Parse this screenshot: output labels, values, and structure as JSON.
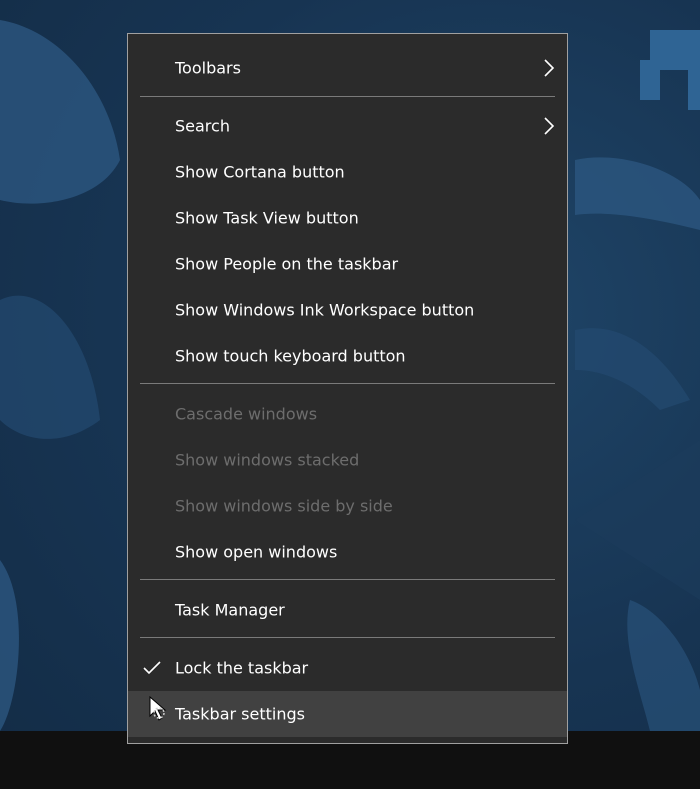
{
  "menu": {
    "items": [
      {
        "label": "Toolbars",
        "enabled": true,
        "has_submenu": true,
        "checked": false
      },
      {
        "label": "Search",
        "enabled": true,
        "has_submenu": true,
        "checked": false
      },
      {
        "label": "Show Cortana button",
        "enabled": true,
        "has_submenu": false,
        "checked": false
      },
      {
        "label": "Show Task View button",
        "enabled": true,
        "has_submenu": false,
        "checked": false
      },
      {
        "label": "Show People on the taskbar",
        "enabled": true,
        "has_submenu": false,
        "checked": false
      },
      {
        "label": "Show Windows Ink Workspace button",
        "enabled": true,
        "has_submenu": false,
        "checked": false
      },
      {
        "label": "Show touch keyboard button",
        "enabled": true,
        "has_submenu": false,
        "checked": false
      },
      {
        "label": "Cascade windows",
        "enabled": false,
        "has_submenu": false,
        "checked": false
      },
      {
        "label": "Show windows stacked",
        "enabled": false,
        "has_submenu": false,
        "checked": false
      },
      {
        "label": "Show windows side by side",
        "enabled": false,
        "has_submenu": false,
        "checked": false
      },
      {
        "label": "Show open windows",
        "enabled": true,
        "has_submenu": false,
        "checked": false
      },
      {
        "label": "Task Manager",
        "enabled": true,
        "has_submenu": false,
        "checked": false
      },
      {
        "label": "Lock the taskbar",
        "enabled": true,
        "has_submenu": false,
        "checked": true
      },
      {
        "label": "Taskbar settings",
        "enabled": true,
        "has_submenu": false,
        "checked": false,
        "hovered": true
      }
    ]
  },
  "icons": {
    "submenu": "chevron-right-icon",
    "checked": "checkmark-icon",
    "pointer": "busy-pointer-icon"
  },
  "colors": {
    "menu_background": "#2b2b2b",
    "menu_border": "#a0a0a0",
    "text": "#ffffff",
    "text_disabled": "#6d6d6d",
    "hover": "#414141",
    "separator": "#7a7a7a",
    "taskbar": "#101010",
    "wallpaper": "#173452"
  }
}
